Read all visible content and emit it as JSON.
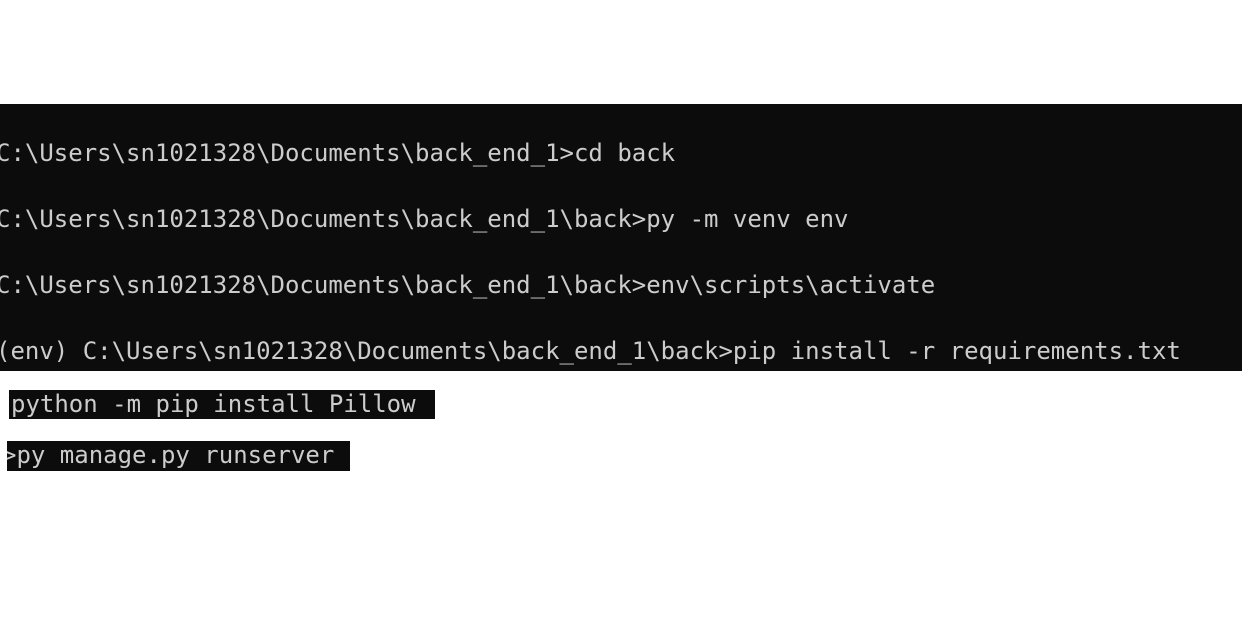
{
  "terminal": {
    "lines": [
      "C:\\Users\\sn1021328\\Documents\\back_end_1>cd back",
      "C:\\Users\\sn1021328\\Documents\\back_end_1\\back>py -m venv env",
      "C:\\Users\\sn1021328\\Documents\\back_end_1\\back>env\\scripts\\activate",
      "(env) C:\\Users\\sn1021328\\Documents\\back_end_1\\back>pip install -r requirements.txt"
    ]
  },
  "snippets": [
    "python -m pip install Pillow",
    ">py manage.py runserver"
  ]
}
